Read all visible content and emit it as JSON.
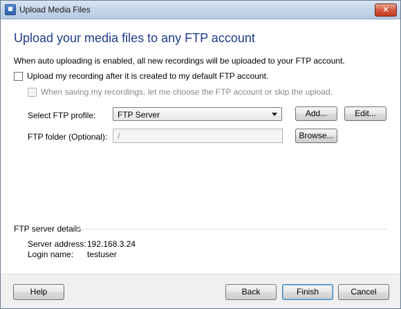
{
  "window": {
    "title": "Upload Media Files",
    "close_glyph": "✕"
  },
  "main": {
    "heading": "Upload your media files to any FTP account",
    "description": "When auto uploading is enabled, all new recordings will be uploaded to your FTP account.",
    "auto_upload_checkbox": {
      "label": "Upload my recording after it is created to my default FTP account.",
      "checked": false
    },
    "choose_account_checkbox": {
      "label": "When saving my recordings, let me choose the FTP account or skip the upload.",
      "checked": false,
      "enabled": false
    },
    "ftp_profile": {
      "label": "Select FTP profile:",
      "value": "FTP Server"
    },
    "ftp_folder": {
      "label": "FTP folder (Optional):",
      "value": "/"
    },
    "buttons": {
      "add": "Add...",
      "edit": "Edit...",
      "browse": "Browse..."
    }
  },
  "details": {
    "section_title": "FTP server details",
    "server_address_label": "Server address:",
    "server_address": "192.168.3.24",
    "login_name_label": "Login name:",
    "login_name": "testuser"
  },
  "footer": {
    "help": "Help",
    "back": "Back",
    "finish": "Finish",
    "cancel": "Cancel"
  },
  "colors": {
    "heading": "#1e3c8c",
    "titlebar": "#c6d6ea",
    "close": "#c23a1e"
  }
}
